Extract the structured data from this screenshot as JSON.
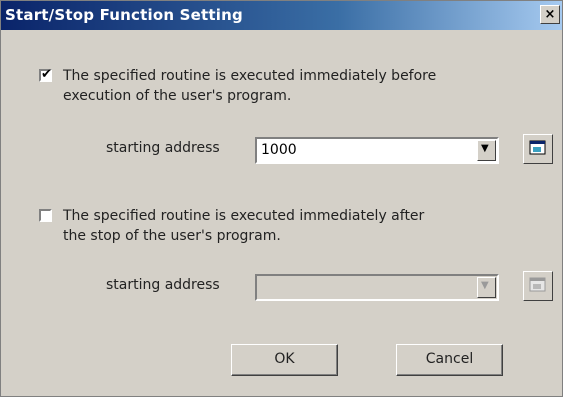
{
  "window": {
    "title": "Start/Stop Function Setting",
    "close_glyph": "×"
  },
  "section_start": {
    "checked": true,
    "check_glyph": "✔",
    "line1": "The specified routine is executed immediately before",
    "line2": "execution of the user's program.",
    "address_label": "starting address",
    "address_value": "1000",
    "enabled": true,
    "browse_icon": "browse-icon"
  },
  "section_stop": {
    "checked": false,
    "check_glyph": "",
    "line1": "The specified routine is executed immediately after",
    "line2": "the stop of the user's  program.",
    "address_label": "starting address",
    "address_value": "",
    "enabled": false,
    "browse_icon": "browse-icon"
  },
  "buttons": {
    "ok": "OK",
    "cancel": "Cancel"
  },
  "dropdown_glyph": "▼"
}
